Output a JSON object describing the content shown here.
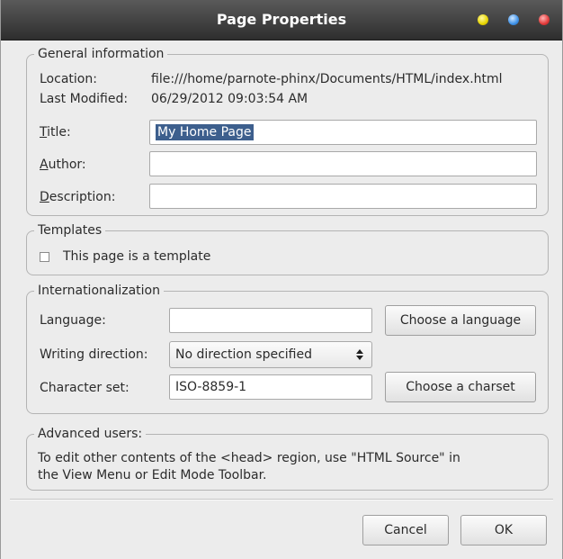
{
  "window": {
    "title": "Page Properties"
  },
  "general": {
    "legend": "General information",
    "location_label": "Location:",
    "location_value": "file:///home/parnote-phinx/Documents/HTML/index.html",
    "modified_label": "Last Modified:",
    "modified_value": "06/29/2012 09:03:54 AM",
    "title_label_key": "T",
    "title_label_rest": "itle:",
    "title_value": "My Home Page",
    "author_label_key": "A",
    "author_label_rest": "uthor:",
    "author_value": "",
    "description_label_key": "D",
    "description_label_rest": "escription:",
    "description_value": ""
  },
  "templates": {
    "legend": "Templates",
    "checkbox_label": "This page is a template",
    "checked": false
  },
  "i18n": {
    "legend": "Internationalization",
    "language_label": "Language:",
    "language_value": "",
    "choose_language": "Choose a language",
    "direction_label": "Writing direction:",
    "direction_value": "No direction specified",
    "charset_label": "Character set:",
    "charset_value": "ISO-8859-1",
    "choose_charset": "Choose a charset"
  },
  "advanced": {
    "legend": "Advanced users:",
    "line1": "To edit other contents of the <head> region, use \"HTML Source\" in",
    "line2": "the View Menu or Edit Mode Toolbar."
  },
  "buttons": {
    "cancel": "Cancel",
    "ok": "OK"
  },
  "icons": {
    "window_controls": [
      "minimize-dot-icon",
      "maximize-dot-icon",
      "close-dot-icon"
    ],
    "dropdown": "updown-arrows-icon"
  },
  "colors": {
    "titlebar": "#3a3a3a",
    "selection": "#3d5f8d",
    "panel": "#ececec"
  }
}
